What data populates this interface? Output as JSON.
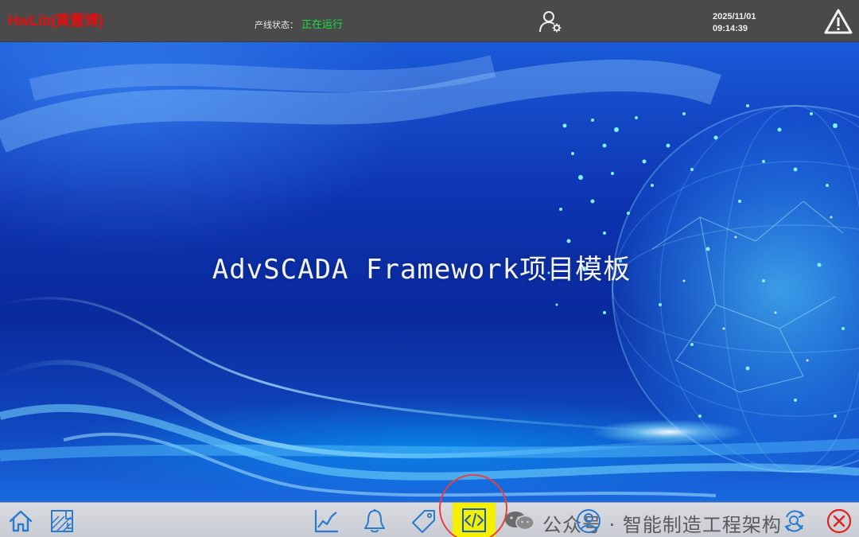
{
  "topbar": {
    "brand": "HwLib(黄薏博)",
    "status_label": "产线状态：",
    "status_value": "正在运行",
    "date": "2025/11/01",
    "time": "09:14:39",
    "icons": [
      "user-settings-icon",
      "warning-icon"
    ]
  },
  "main": {
    "headline": "AdvSCADA Framework项目模板"
  },
  "bottombar": {
    "buttons": [
      {
        "name": "home-icon"
      },
      {
        "name": "drawing-icon"
      },
      {
        "name": "trend-chart-icon"
      },
      {
        "name": "bell-icon"
      },
      {
        "name": "tag-icon"
      },
      {
        "name": "code-icon",
        "active": true
      },
      {
        "name": "user-icon"
      },
      {
        "name": "refresh-zoom-icon"
      },
      {
        "name": "close-icon"
      }
    ],
    "watermark": "公众号 · 智能制造工程架构"
  },
  "colors": {
    "topbar_bg": "#4a4a4a",
    "brand": "#e01010",
    "status_running": "#18e040",
    "active_button": "#f5f000",
    "close_button": "#e02020",
    "icon_blue": "#2a7ad0"
  }
}
